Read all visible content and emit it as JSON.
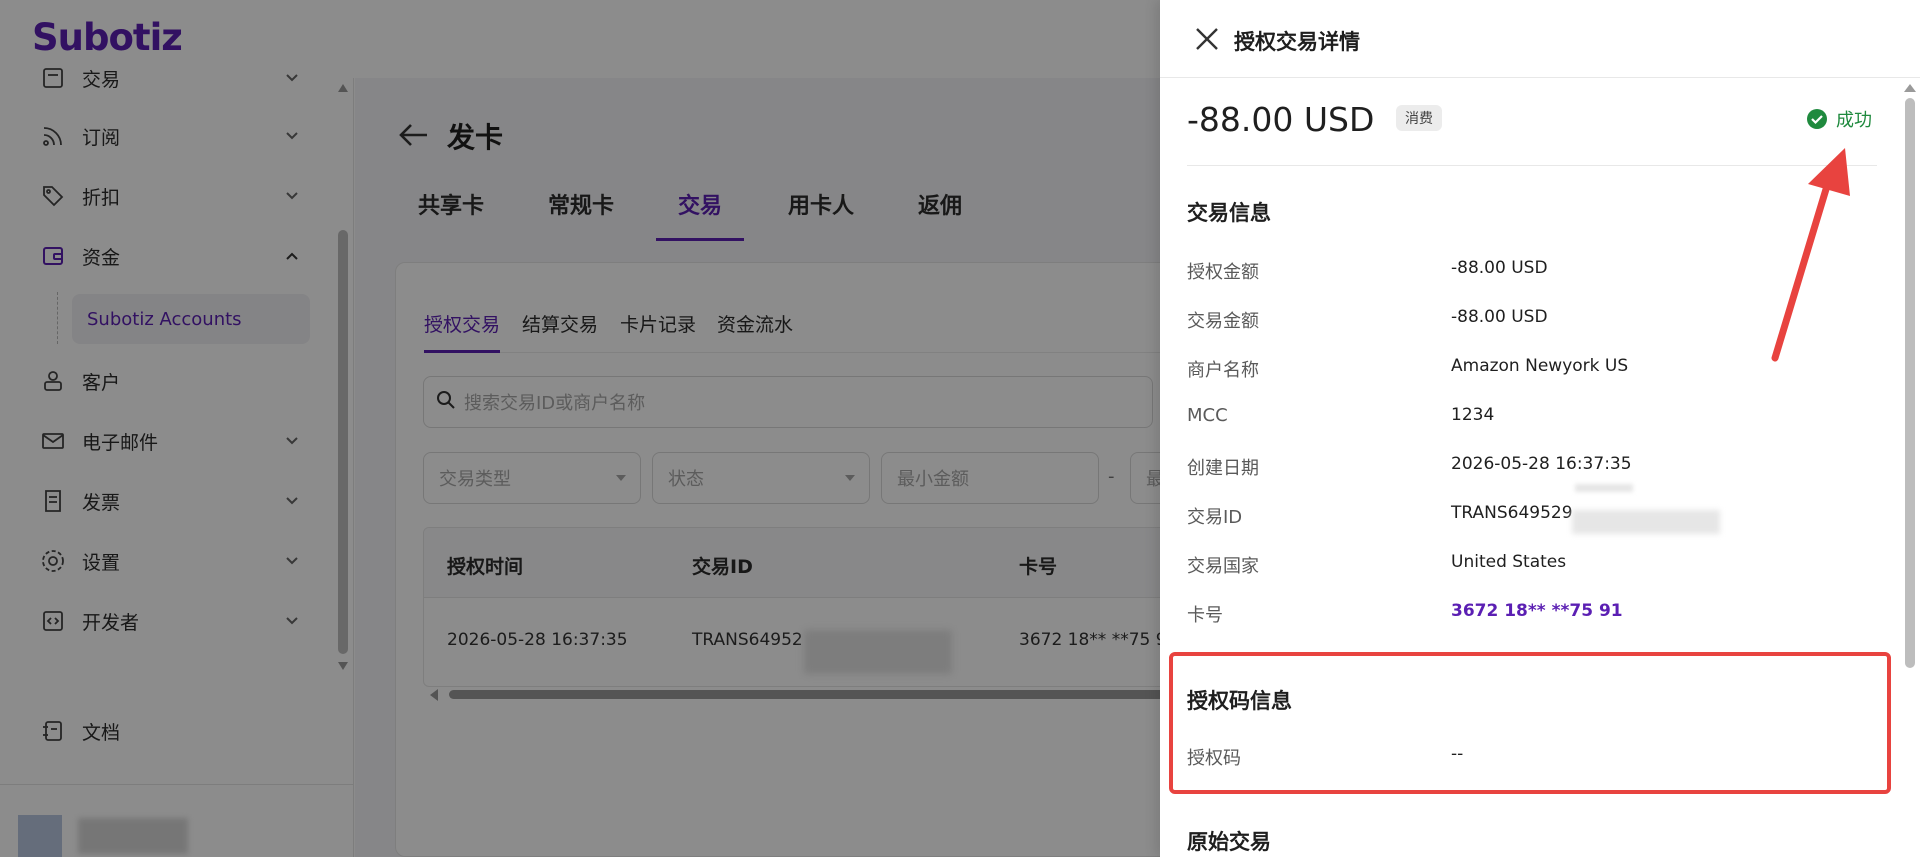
{
  "app": {
    "logo": "Subotiz"
  },
  "sidebar": {
    "items": [
      {
        "label": "交易",
        "icon": "list-icon"
      },
      {
        "label": "订阅",
        "icon": "rss-icon"
      },
      {
        "label": "折扣",
        "icon": "tag-icon"
      },
      {
        "label": "资金",
        "icon": "wallet-icon"
      },
      {
        "label": "Subotiz Accounts"
      },
      {
        "label": "客户",
        "icon": "user-icon"
      },
      {
        "label": "电子邮件",
        "icon": "mail-icon"
      },
      {
        "label": "发票",
        "icon": "invoice-icon"
      },
      {
        "label": "设置",
        "icon": "gear-icon"
      },
      {
        "label": "开发者",
        "icon": "code-icon"
      },
      {
        "label": "文档",
        "icon": "doc-icon"
      }
    ]
  },
  "main": {
    "title": "发卡",
    "tabs": [
      "共享卡",
      "常规卡",
      "交易",
      "用卡人",
      "返佣"
    ],
    "active_tab": "交易",
    "sub_tabs": [
      "授权交易",
      "结算交易",
      "卡片记录",
      "资金流水"
    ],
    "search_placeholder": "搜索交易ID或商户名称",
    "filters": [
      "交易类型",
      "状态",
      "最小金额",
      "最"
    ],
    "filter_dash": "-",
    "table": {
      "headers": [
        "授权时间",
        "交易ID",
        "卡号"
      ],
      "rows": [
        [
          "2026-05-28 16:37:35",
          "TRANS64952",
          "3672 18** **75 9"
        ]
      ]
    }
  },
  "drawer": {
    "title": "授权交易详情",
    "amount": "-88.00 USD",
    "type_badge": "消费",
    "status": "成功",
    "sections": {
      "transaction": {
        "title": "交易信息",
        "rows": [
          {
            "label": "授权金额",
            "value": "-88.00 USD"
          },
          {
            "label": "交易金额",
            "value": "-88.00 USD"
          },
          {
            "label": "商户名称",
            "value": "Amazon Newyork US"
          },
          {
            "label": "MCC",
            "value": "1234"
          },
          {
            "label": "创建日期",
            "value": "2026-05-28 16:37:35"
          },
          {
            "label": "交易ID",
            "value": "TRANS649529"
          },
          {
            "label": "交易国家",
            "value": "United States"
          },
          {
            "label": "卡号",
            "value": "3672 18** **75 91"
          }
        ]
      },
      "auth_code": {
        "title": "授权码信息",
        "rows": [
          {
            "label": "授权码",
            "value": "--"
          }
        ]
      },
      "original": {
        "title": "原始交易"
      }
    }
  },
  "colors": {
    "brand": "#5b1fb3",
    "success": "#1f8a3e",
    "highlight": "#e8433f"
  }
}
